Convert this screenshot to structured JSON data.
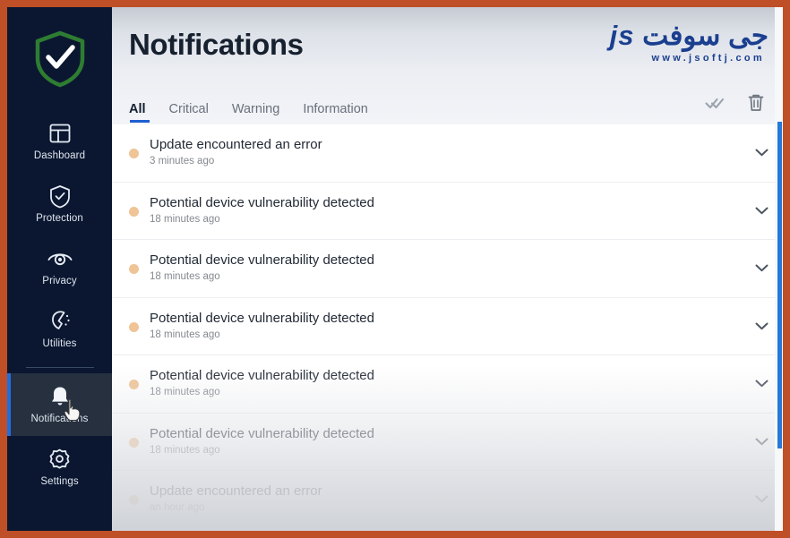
{
  "theme": {
    "frame_border_color": "#bf4f26",
    "sidebar_bg": "#0b1730",
    "accent_blue": "#1f6fe0",
    "shield_green": "#2e7d32",
    "dot_color": "#efc496",
    "scrollbar_color": "#2579d8"
  },
  "sidebar": {
    "logo_icon": "shield-check-icon",
    "items": [
      {
        "label": "Dashboard",
        "icon": "dashboard-layout-icon",
        "active": false
      },
      {
        "label": "Protection",
        "icon": "shield-check-icon",
        "active": false
      },
      {
        "label": "Privacy",
        "icon": "eye-icon",
        "active": false
      },
      {
        "label": "Utilities",
        "icon": "utilities-icon",
        "active": false
      },
      {
        "label": "Notifications",
        "icon": "bell-icon",
        "active": true
      },
      {
        "label": "Settings",
        "icon": "gear-icon",
        "active": false
      }
    ]
  },
  "header": {
    "title": "Notifications",
    "watermark": {
      "arabic": "جى سوفت",
      "logo_text": "js",
      "url": "www.jsoftj.com"
    },
    "actions": [
      {
        "name": "mark-all-read-button",
        "icon": "double-check-icon"
      },
      {
        "name": "delete-all-button",
        "icon": "trash-icon"
      }
    ]
  },
  "tabs": [
    {
      "label": "All",
      "active": true
    },
    {
      "label": "Critical",
      "active": false
    },
    {
      "label": "Warning",
      "active": false
    },
    {
      "label": "Information",
      "active": false
    }
  ],
  "notifications": [
    {
      "title": "Update encountered an error",
      "time": "3 minutes ago",
      "severity": "warning",
      "expand_icon": "chevron-down-icon"
    },
    {
      "title": "Potential device vulnerability detected",
      "time": "18 minutes ago",
      "severity": "warning",
      "expand_icon": "chevron-down-icon"
    },
    {
      "title": "Potential device vulnerability detected",
      "time": "18 minutes ago",
      "severity": "warning",
      "expand_icon": "chevron-down-icon"
    },
    {
      "title": "Potential device vulnerability detected",
      "time": "18 minutes ago",
      "severity": "warning",
      "expand_icon": "chevron-down-icon"
    },
    {
      "title": "Potential device vulnerability detected",
      "time": "18 minutes ago",
      "severity": "warning",
      "expand_icon": "chevron-down-icon"
    },
    {
      "title": "Potential device vulnerability detected",
      "time": "18 minutes ago",
      "severity": "warning",
      "expand_icon": "chevron-down-icon"
    },
    {
      "title": "Update encountered an error",
      "time": "an hour ago",
      "severity": "warning",
      "expand_icon": "chevron-down-icon"
    }
  ]
}
